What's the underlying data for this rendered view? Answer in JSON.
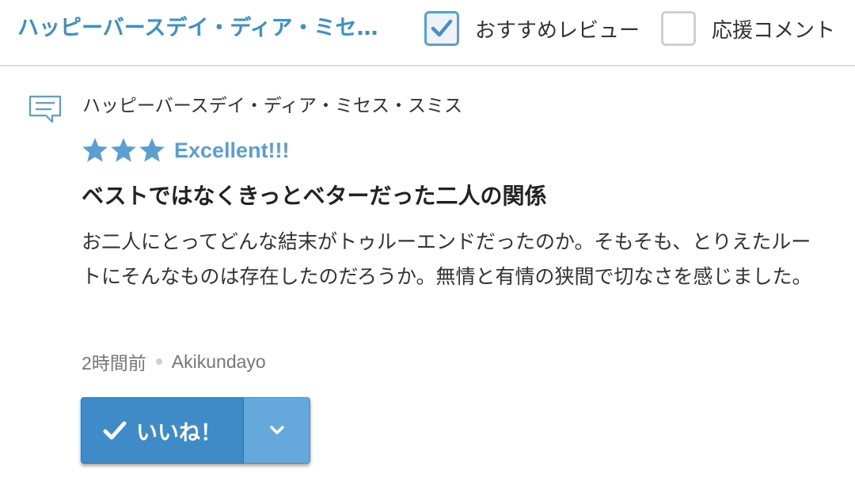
{
  "header": {
    "title": "ハッピーバースデイ・ディア・ミセス・スミス",
    "filters": [
      {
        "label": "おすすめレビュー",
        "checked": true
      },
      {
        "label": "応援コメント",
        "checked": false
      }
    ]
  },
  "review": {
    "work_title": "ハッピーバースデイ・ディア・ミセス・スミス",
    "stars": 3,
    "rating_label": "Excellent!!!",
    "headline": "ベストではなくきっとベターだった二人の関係",
    "body": "お二人にとってどんな結末がトゥルーエンドだったのか。そもそも、とりえたルートにそんなものは存在したのだろうか。無情と有情の狭間で切なさを感じました。",
    "time_ago": "2時間前",
    "author": "Akikundayo",
    "like_label": "いいね！"
  },
  "colors": {
    "accent": "#3c90c9",
    "star": "#5a9fd4",
    "button": "#3f8bc8",
    "button_dropdown": "#64a8dc"
  },
  "icons": {
    "comment": "comment-bubble-icon",
    "check": "checkmark-icon",
    "dropdown": "chevron-down-icon",
    "star": "star-icon"
  }
}
